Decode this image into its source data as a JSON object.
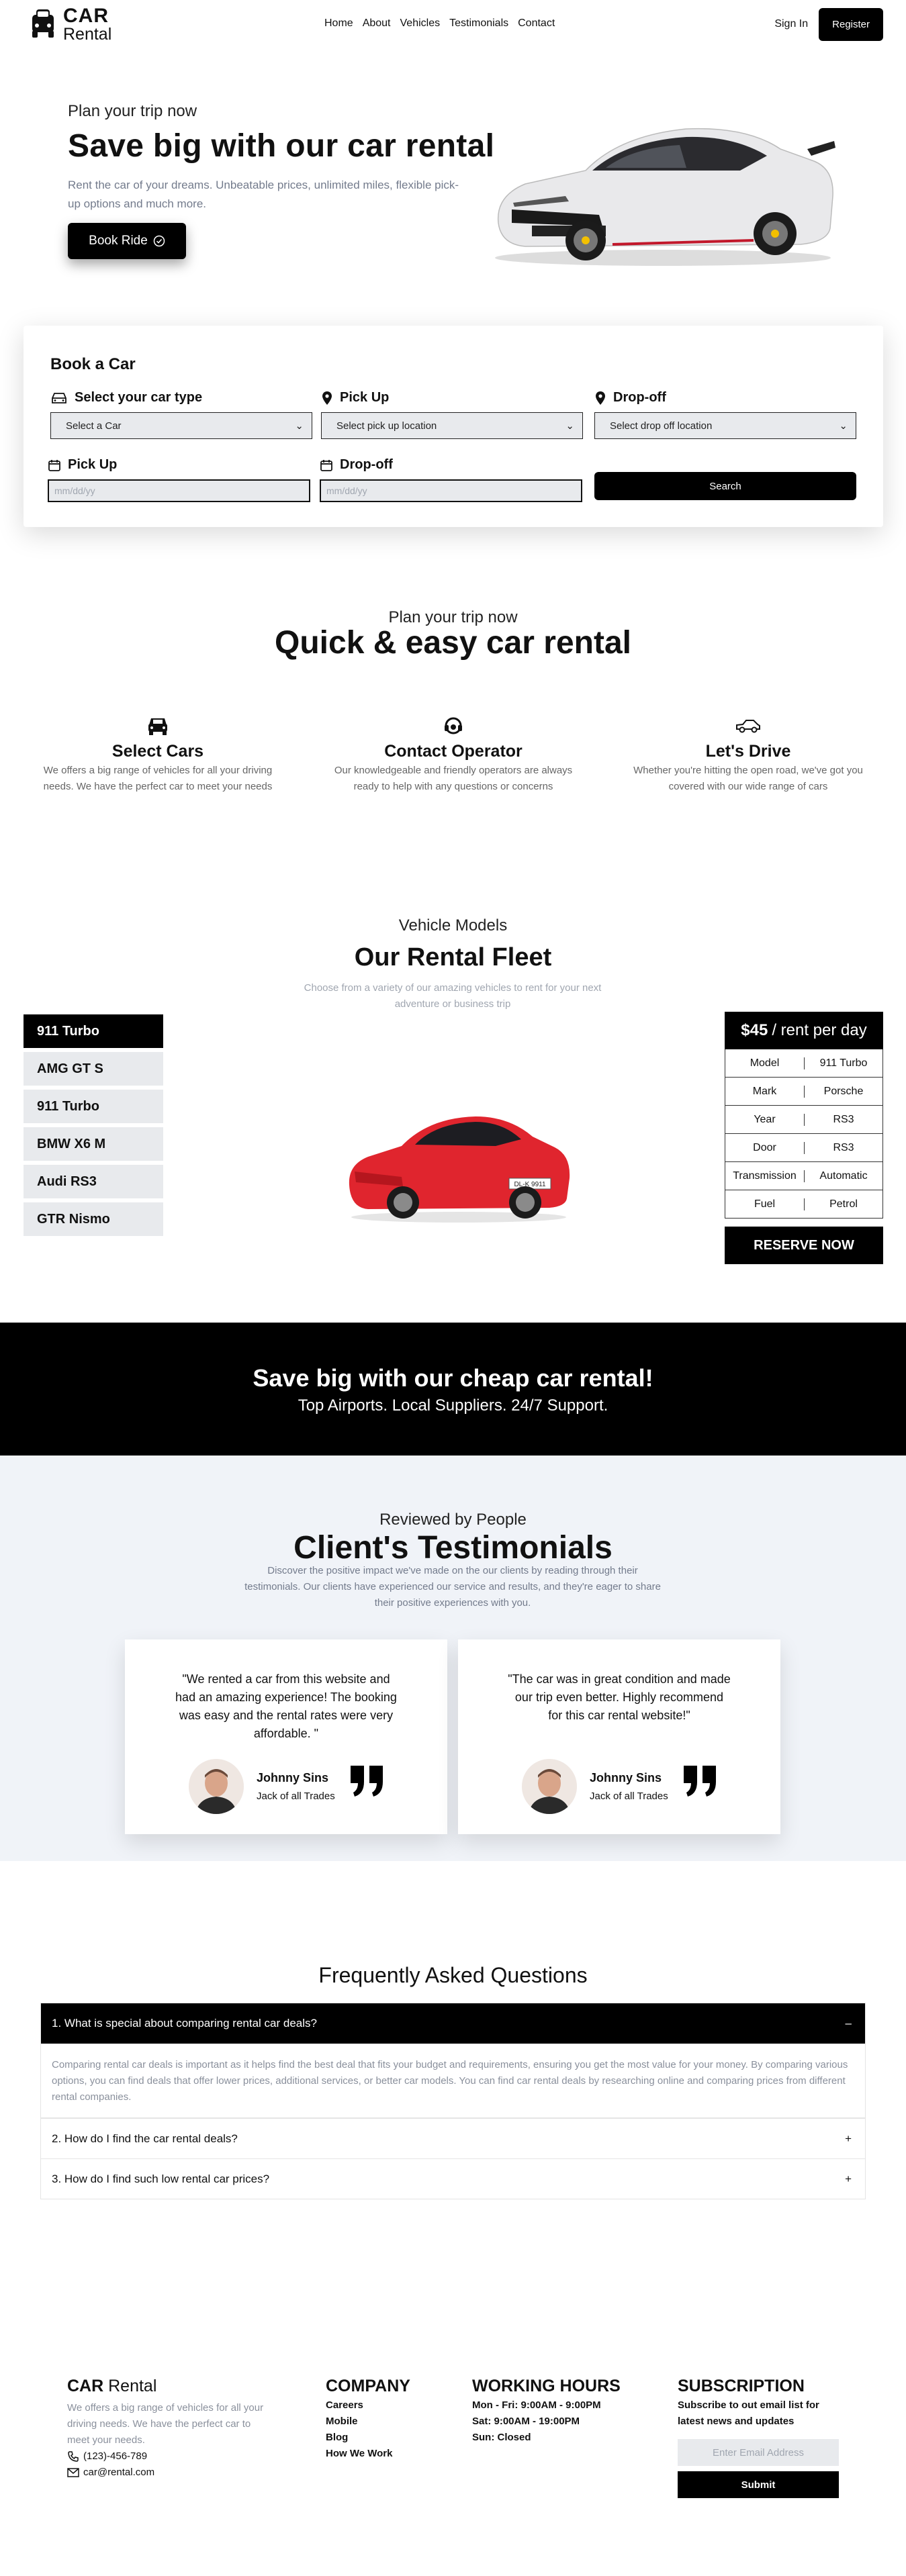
{
  "nav": {
    "logo_line1": "CAR",
    "logo_line2": "Rental",
    "links": [
      "Home",
      "About",
      "Vehicles",
      "Testimonials",
      "Contact"
    ],
    "sign_in": "Sign In",
    "register": "Register"
  },
  "hero": {
    "subtitle": "Plan your trip now",
    "title": "Save big with our car rental",
    "description": "Rent the car of your dreams. Unbeatable prices, unlimited miles, flexible pick-up options and much more.",
    "cta": "Book Ride"
  },
  "booking": {
    "title": "Book a Car",
    "car_type_label": "Select your car type",
    "car_type_value": "Select a Car",
    "pickup_label": "Pick Up",
    "pickup_value": "Select pick up location",
    "dropoff_label": "Drop-off",
    "dropoff_value": "Select drop off location",
    "pickup_date_label": "Pick Up",
    "pickup_date_placeholder": "mm/dd/yy",
    "dropoff_date_label": "Drop-off",
    "dropoff_date_placeholder": "mm/dd/yy",
    "search": "Search"
  },
  "quick": {
    "subtitle": "Plan your trip now",
    "title": "Quick & easy car rental",
    "features": [
      {
        "title": "Select Cars",
        "text": "We offers a big range of vehicles for all your driving needs. We have the perfect car to meet your needs",
        "icon": "car-front-icon"
      },
      {
        "title": "Contact Operator",
        "text": "Our knowledgeable and friendly operators are always ready to help with any questions or concerns",
        "icon": "operator-icon"
      },
      {
        "title": "Let's Drive",
        "text": "Whether you're hitting the open road, we've got you covered with our wide range of cars",
        "icon": "car-side-icon"
      }
    ]
  },
  "fleet": {
    "subtitle": "Vehicle Models",
    "title": "Our Rental Fleet",
    "description": "Choose from a variety of our amazing vehicles to rent for your next adventure or business trip",
    "models": [
      "911 Turbo",
      "AMG GT S",
      "911 Turbo",
      "BMW X6 M",
      "Audi RS3",
      "GTR Nismo"
    ],
    "price": "$45",
    "price_unit": "/ rent per day",
    "specs": [
      {
        "k": "Model",
        "v": "911 Turbo"
      },
      {
        "k": "Mark",
        "v": "Porsche"
      },
      {
        "k": "Year",
        "v": "RS3"
      },
      {
        "k": "Door",
        "v": "RS3"
      },
      {
        "k": "Transmission",
        "v": "Automatic"
      },
      {
        "k": "Fuel",
        "v": "Petrol"
      }
    ],
    "reserve": "RESERVE NOW",
    "car_plate": "DL-K 9911",
    "car_color": "#e0252e"
  },
  "banner": {
    "title": "Save big with our cheap car rental!",
    "text": "Top Airports. Local Suppliers. 24/7 Support."
  },
  "testimonials": {
    "subtitle": "Reviewed by People",
    "title": "Client's Testimonials",
    "description": "Discover the positive impact we've made on the our clients by reading through their testimonials. Our clients have experienced our service and results, and they're eager to share their positive experiences with you.",
    "items": [
      {
        "quote": "\"We rented a car from this website and had an amazing experience! The booking was easy and the rental rates were very affordable. \"",
        "name": "Johnny Sins",
        "role": "Jack of all Trades"
      },
      {
        "quote": "\"The car was in great condition and made our trip even better. Highly recommend for this car rental website!\"",
        "name": "Johnny Sins",
        "role": "Jack of all Trades"
      }
    ]
  },
  "faq": {
    "title": "Frequently Asked Questions",
    "items": [
      {
        "q": "1. What is special about comparing rental car deals?",
        "toggle": "–",
        "a": "Comparing rental car deals is important as it helps find the best deal that fits your budget and requirements, ensuring you get the most value for your money. By comparing various options, you can find deals that offer lower prices, additional services, or better car models. You can find car rental deals by researching online and comparing prices from different rental companies."
      },
      {
        "q": "2. How do I find the car rental deals?",
        "toggle": "+"
      },
      {
        "q": "3. How do I find such low rental car prices?",
        "toggle": "+"
      }
    ]
  },
  "footer": {
    "brand_bold": "CAR",
    "brand_rest": "Rental",
    "about": "We offers a big range of vehicles for all your driving needs. We have the perfect car to meet your needs.",
    "phone": "(123)-456-789",
    "email": "car@rental.com",
    "company_title": "COMPANY",
    "company_links": [
      "Careers",
      "Mobile",
      "Blog",
      "How We Work"
    ],
    "hours_title": "WORKING HOURS",
    "hours": [
      "Mon - Fri: 9:00AM - 9:00PM",
      "Sat: 9:00AM - 19:00PM",
      "Sun: Closed"
    ],
    "sub_title": "SUBSCRIPTION",
    "sub_text": "Subscribe to out email list for latest news and updates",
    "email_placeholder": "Enter Email Address",
    "submit": "Submit"
  }
}
